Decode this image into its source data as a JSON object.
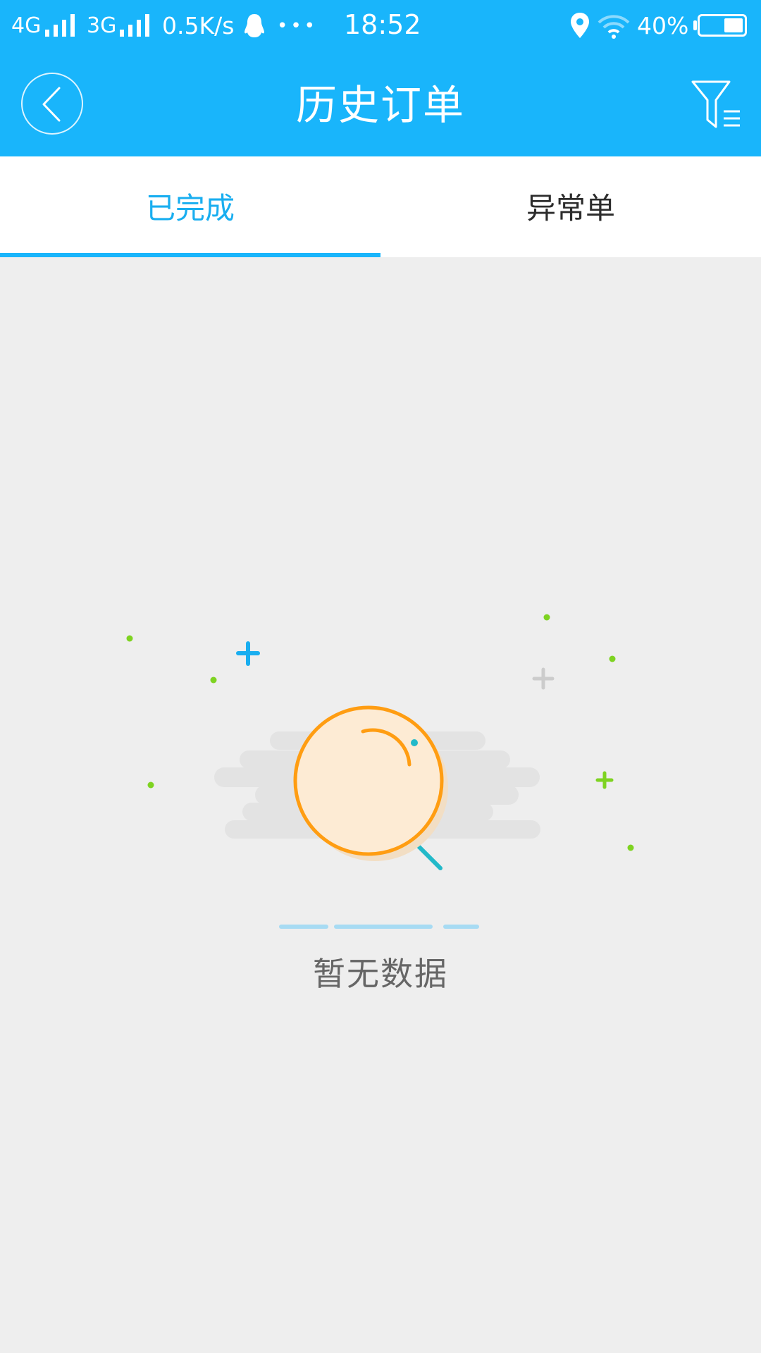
{
  "status_bar": {
    "network1": "4G",
    "network2": "3G",
    "speed": "0.5K/s",
    "dots": "•••",
    "time": "18:52",
    "battery": "40%",
    "icons": [
      "signal-icon",
      "qq-icon",
      "location-icon",
      "wifi-icon",
      "battery-icon"
    ]
  },
  "header": {
    "title": "历史订单",
    "back_icon": "back-chevron-icon",
    "filter_icon": "filter-icon"
  },
  "tabs": [
    {
      "label": "已完成",
      "active": true
    },
    {
      "label": "异常单",
      "active": false
    }
  ],
  "empty_state": {
    "message": "暂无数据",
    "illustration_icon": "magnifier-empty-icon"
  },
  "colors": {
    "primary": "#19b5fb",
    "tab_active_text": "#19aef0",
    "background": "#eeeeee",
    "accent_orange": "#ff9d12",
    "accent_green": "#7ed321"
  }
}
